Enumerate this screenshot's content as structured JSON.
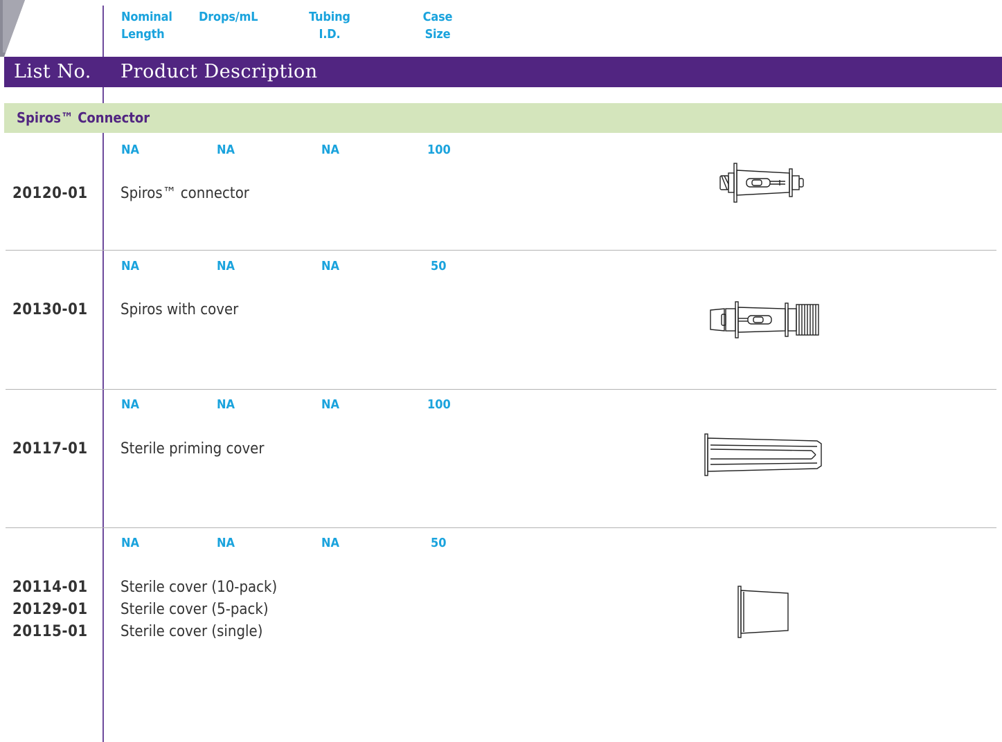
{
  "columns": {
    "nominal_length": "Nominal Length",
    "drops_per_ml": "Drops/mL",
    "tubing_id": "Tubing I.D.",
    "case_size": "Case Size"
  },
  "header": {
    "list_no": "List No.",
    "product_description": "Product Description"
  },
  "section": {
    "title": "Spiros™ Connector"
  },
  "rows": [
    {
      "nominal_length": "NA",
      "drops_per_ml": "NA",
      "tubing_id": "NA",
      "case_size": "100",
      "list_nos": [
        "20120-01"
      ],
      "descriptions": [
        "Spiros™ connector"
      ],
      "image_icon": "spiros-connector-drawing"
    },
    {
      "nominal_length": "NA",
      "drops_per_ml": "NA",
      "tubing_id": "NA",
      "case_size": "50",
      "list_nos": [
        "20130-01"
      ],
      "descriptions": [
        "Spiros with cover"
      ],
      "image_icon": "spiros-with-cover-drawing"
    },
    {
      "nominal_length": "NA",
      "drops_per_ml": "NA",
      "tubing_id": "NA",
      "case_size": "100",
      "list_nos": [
        "20117-01"
      ],
      "descriptions": [
        "Sterile priming cover"
      ],
      "image_icon": "priming-cover-drawing"
    },
    {
      "nominal_length": "NA",
      "drops_per_ml": "NA",
      "tubing_id": "NA",
      "case_size": "50",
      "list_nos": [
        "20114-01",
        "20129-01",
        "20115-01"
      ],
      "descriptions": [
        "Sterile cover (10-pack)",
        "Sterile cover (5-pack)",
        "Sterile cover (single)"
      ],
      "image_icon": "sterile-cover-drawing"
    }
  ],
  "colors": {
    "purple": "#512581",
    "light_green": "#d4e5bc",
    "cyan": "#1aa3dd",
    "text": "#333333"
  }
}
